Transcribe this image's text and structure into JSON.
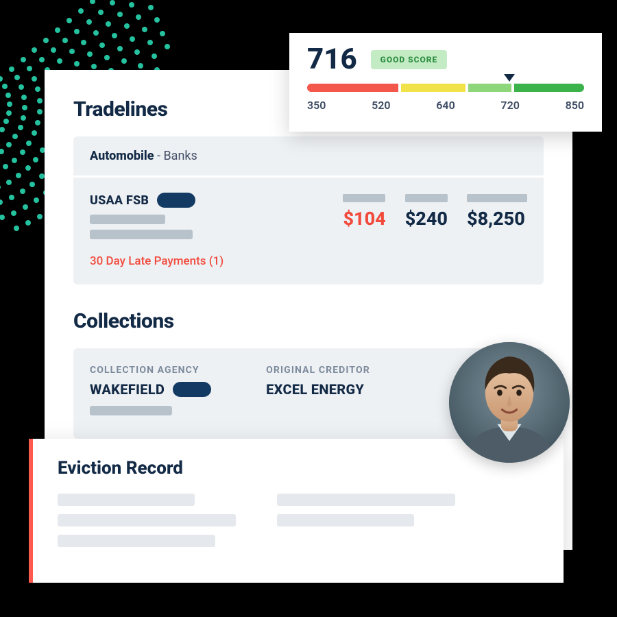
{
  "score": {
    "value": "716",
    "badge": "GOOD SCORE",
    "ticks": [
      "350",
      "520",
      "640",
      "720",
      "850"
    ],
    "marker_percent": 73
  },
  "tradelines": {
    "title": "Tradelines",
    "header_strong": "Automobile",
    "header_rest": " - Banks",
    "creditor": "USAA FSB",
    "amounts": [
      "$104",
      "$240",
      "$8,250"
    ],
    "late": "30 Day Late Payments (1)"
  },
  "collections": {
    "title": "Collections",
    "agency_label": "COLLECTION AGENCY",
    "agency_value": "WAKEFIELD",
    "creditor_label": "ORIGINAL CREDITOR",
    "creditor_value": "EXCEL ENERGY"
  },
  "eviction": {
    "title": "Eviction Record"
  }
}
